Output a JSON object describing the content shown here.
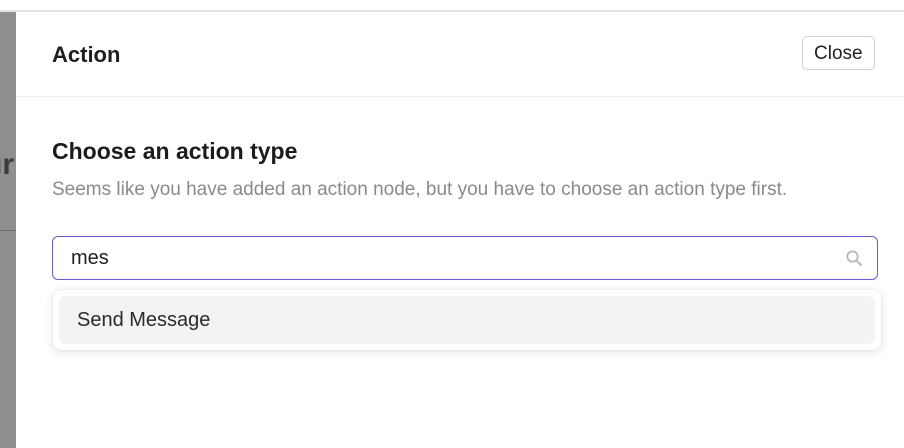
{
  "drawer": {
    "title": "Action",
    "close_label": "Close"
  },
  "section": {
    "title": "Choose an action type",
    "description": "Seems like you have added an action node, but you have to choose an action type first."
  },
  "search": {
    "value": "mes",
    "icon": "search-icon"
  },
  "dropdown": {
    "options": [
      {
        "label": "Send Message"
      }
    ]
  },
  "colors": {
    "focus_border": "#6b5bd6",
    "option_hover": "#f3f3f3",
    "overlay": "#8f8f8f"
  }
}
